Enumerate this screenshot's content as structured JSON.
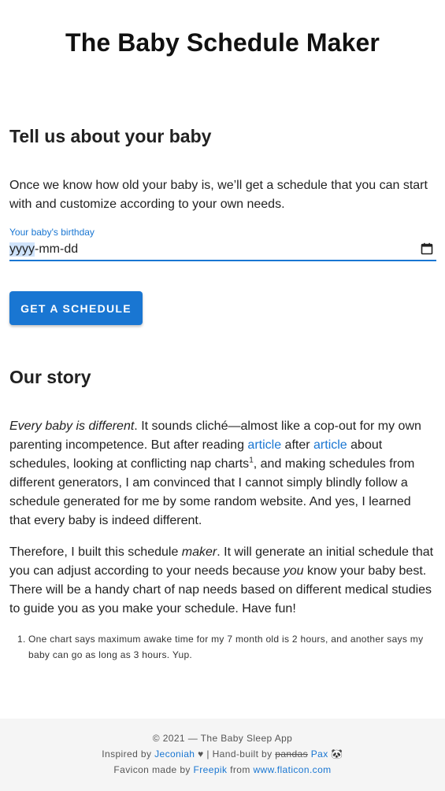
{
  "app": {
    "title": "The Baby Schedule Maker"
  },
  "intro": {
    "heading": "Tell us about your baby",
    "text": "Once we know how old your baby is, we’ll get a schedule that you can start with and customize according to your own needs."
  },
  "form": {
    "birthday_label": "Your baby's birthday",
    "date_year_placeholder": "yyyy",
    "date_rest_placeholder": "-mm-dd",
    "submit_label": "Get a schedule"
  },
  "story": {
    "heading": "Our story",
    "p1": {
      "em_lead": "Every baby is different",
      "t1": ". It sounds cliché—almost like a cop-out for my own parenting incompetence. But after reading ",
      "link1": "article",
      "t2": " after ",
      "link2": "article",
      "t3": " about schedules, looking at conflicting nap charts",
      "sup": "1",
      "t4": ", and making schedules from different generators, I am convinced that I cannot simply blindly follow a schedule generated for me by some random website. And yes, I learned that every baby is indeed different."
    },
    "p2": {
      "t1": "Therefore, I built this schedule ",
      "em1": "maker",
      "t2": ". It will generate an initial schedule that you can adjust according to your needs because ",
      "em2": "you",
      "t3": " know your baby best. There will be a handy chart of nap needs based on different medical studies to guide you as you make your schedule. Have fun!"
    },
    "footnote": {
      "number": "1.",
      "text": "One chart says maximum awake time for my 7 month old is 2 hours, and another says my baby can go as long as 3 hours. Yup."
    }
  },
  "footer": {
    "copyright": "© 2021 — The Baby Sleep App",
    "inspired_prefix": "Inspired by ",
    "inspired_link": "Jeconiah",
    "heart": "♥",
    "built_prefix": " | Hand-built by ",
    "built_strike": "pandas",
    "built_link": "Pax",
    "panda": "🐼",
    "favicon_prefix": "Favicon made by ",
    "favicon_link": "Freepik",
    "favicon_mid": " from ",
    "favicon_site": "www.flaticon.com"
  },
  "colors": {
    "accent": "#1976d2",
    "footer_bg": "#f5f5f5",
    "text": "#212121"
  }
}
